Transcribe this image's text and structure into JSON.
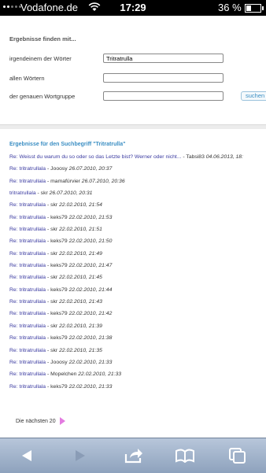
{
  "status": {
    "carrier": "Vodafone.de",
    "time": "17:29",
    "battery": "36 %",
    "battery_level": 0.36
  },
  "form": {
    "heading": "Ergebnisse finden mit...",
    "any_words_label": "irgendeinem der Wörter",
    "any_words_value": "Tritratrulla",
    "all_words_label": "allen Wörtern",
    "all_words_value": "",
    "exact_phrase_label": "der genauen Wortgruppe",
    "exact_phrase_value": "",
    "search_button": "suchen"
  },
  "results": {
    "title": "Ergebnisse für den Suchbegriff \"Tritratrulla\"",
    "items": [
      {
        "topic": "Re: Weisst du warum du so oder so das Letzte bist? Werner oder nicht...",
        "author": " - Tabsi83 ",
        "date": "04.06.2013, 18:"
      },
      {
        "topic": "Re: tritratrullala",
        "author": " - Jooosy ",
        "date": "26.07.2010, 20:37"
      },
      {
        "topic": "Re: tritratrullala",
        "author": " - mamafürvier ",
        "date": "26.07.2010, 20:36"
      },
      {
        "topic": "tritratrullala",
        "author": " - skr ",
        "date": "26.07.2010, 20:31"
      },
      {
        "topic": "Re: tritratrullala",
        "author": " - skr ",
        "date": "22.02.2010, 21:54"
      },
      {
        "topic": "Re: tritratrullala",
        "author": " - keks79 ",
        "date": "22.02.2010, 21:53"
      },
      {
        "topic": "Re: tritratrullala",
        "author": " - skr ",
        "date": "22.02.2010, 21:51"
      },
      {
        "topic": "Re: tritratrullala",
        "author": " - keks79 ",
        "date": "22.02.2010, 21:50"
      },
      {
        "topic": "Re: tritratrullala",
        "author": " - skr ",
        "date": "22.02.2010, 21:49"
      },
      {
        "topic": "Re: tritratrullala",
        "author": " - keks79 ",
        "date": "22.02.2010, 21:47"
      },
      {
        "topic": "Re: tritratrullala",
        "author": " - skr ",
        "date": "22.02.2010, 21:45"
      },
      {
        "topic": "Re: tritratrullala",
        "author": " - keks79 ",
        "date": "22.02.2010, 21:44"
      },
      {
        "topic": "Re: tritratrullala",
        "author": " - skr ",
        "date": "22.02.2010, 21:43"
      },
      {
        "topic": "Re: tritratrullala",
        "author": " - keks79 ",
        "date": "22.02.2010, 21:42"
      },
      {
        "topic": "Re: tritratrullala",
        "author": " - skr ",
        "date": "22.02.2010, 21:39"
      },
      {
        "topic": "Re: tritratrullala",
        "author": " - keks79 ",
        "date": "22.02.2010, 21:38"
      },
      {
        "topic": "Re: tritratrullala",
        "author": " - skr ",
        "date": "22.02.2010, 21:35"
      },
      {
        "topic": "Re: tritratrullala",
        "author": " - Jooosy ",
        "date": "22.02.2010, 21:33"
      },
      {
        "topic": "Re: tritratrullala",
        "author": " - Mopelchen ",
        "date": "22.02.2010, 21:33"
      },
      {
        "topic": "Re: tritratrullala",
        "author": " - keks79 ",
        "date": "22.02.2010, 21:33"
      }
    ]
  },
  "pagination": {
    "next_label": "Die nächsten 20"
  },
  "toolbar": {
    "icons": [
      "back-icon",
      "forward-icon",
      "share-icon",
      "bookmarks-icon",
      "tabs-icon"
    ]
  },
  "colors": {
    "link": "#3a3aa0",
    "accent": "#3a8ec3",
    "next_arrow": "#e37be0"
  }
}
